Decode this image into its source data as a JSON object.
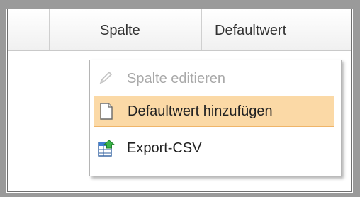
{
  "grid": {
    "columns": [
      {
        "label": ""
      },
      {
        "label": "Spalte"
      },
      {
        "label": "Defaultwert"
      }
    ]
  },
  "context_menu": {
    "items": [
      {
        "label": "Spalte editieren",
        "icon": "pencil-icon",
        "disabled": true
      },
      {
        "label": "Defaultwert hinzufügen",
        "icon": "blank-document-icon",
        "highlighted": true
      },
      {
        "label": "Export-CSV",
        "icon": "spreadsheet-export-icon"
      }
    ]
  },
  "colors": {
    "highlight_bg": "#fbd9a6",
    "highlight_border": "#efb56a",
    "disabled_text": "#a9a9a9"
  }
}
